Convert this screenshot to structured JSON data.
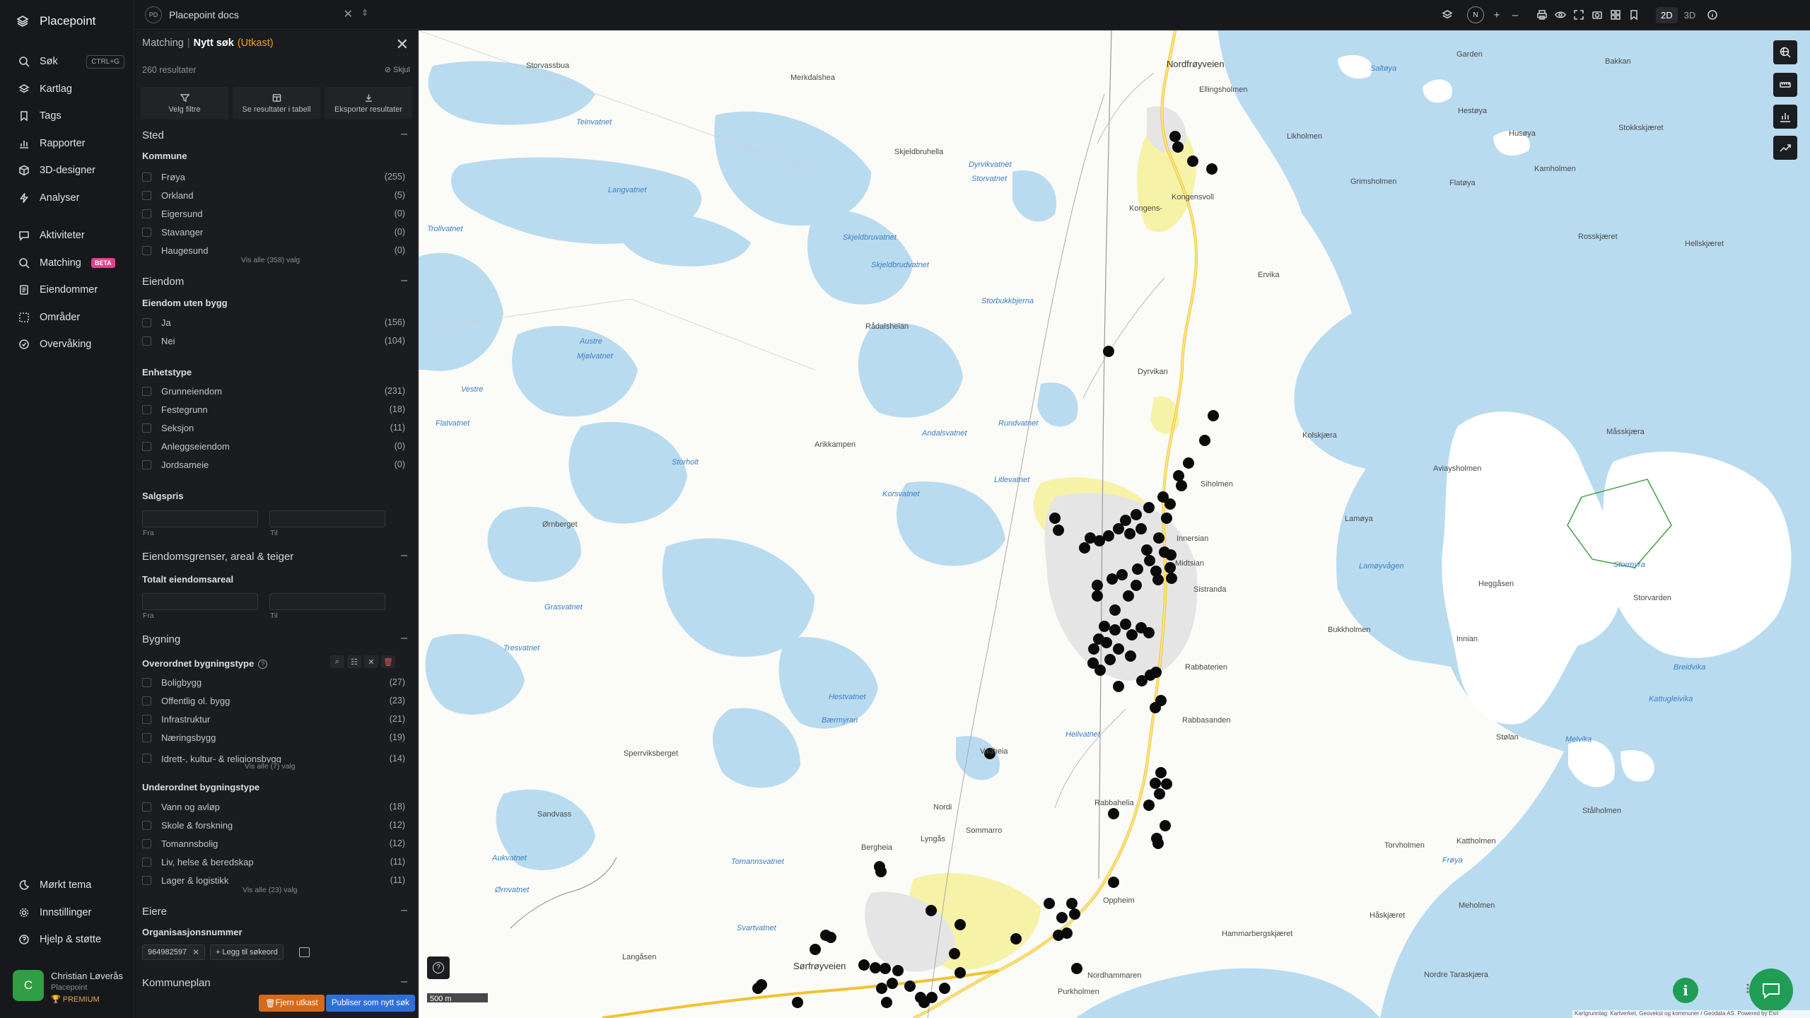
{
  "brand": {
    "name": "Placepoint"
  },
  "nav": {
    "items": [
      {
        "label": "Søk",
        "shortcut": "CTRL+G"
      },
      {
        "label": "Kartlag"
      },
      {
        "label": "Tags"
      },
      {
        "label": "Rapporter"
      },
      {
        "label": "3D-designer"
      },
      {
        "label": "Analyser"
      },
      {
        "label": "Aktiviteter"
      },
      {
        "label": "Matching",
        "badge": "BETA"
      },
      {
        "label": "Eiendommer"
      },
      {
        "label": "Områder"
      },
      {
        "label": "Overvåking"
      }
    ],
    "bottom": [
      {
        "label": "Mørkt tema"
      },
      {
        "label": "Innstillinger"
      },
      {
        "label": "Hjelp & støtte"
      }
    ]
  },
  "user": {
    "initial": "C",
    "name": "Christian Løverås",
    "org": "Placepoint",
    "plan": "PREMIUM"
  },
  "doc": {
    "badge": "PD",
    "title": "Placepoint docs"
  },
  "view": {
    "compass": "N",
    "mode_2d": "2D",
    "mode_3d": "3D"
  },
  "panel": {
    "crumb_parent": "Matching",
    "crumb_current": "Nytt søk",
    "crumb_status": "(Utkast)",
    "count": "260 resultater",
    "hide": "Skjul",
    "actions": [
      "Velg filtre",
      "Se resultater i tabell",
      "Eksporter resultater"
    ],
    "sted": {
      "title": "Sted",
      "kommune_title": "Kommune",
      "options": [
        {
          "label": "Frøya",
          "count": "(255)"
        },
        {
          "label": "Orkland",
          "count": "(5)"
        },
        {
          "label": "Eigersund",
          "count": "(0)"
        },
        {
          "label": "Stavanger",
          "count": "(0)"
        },
        {
          "label": "Haugesund",
          "count": "(0)"
        }
      ],
      "show_all": "Vis alle (358) valg"
    },
    "eiendom": {
      "title": "Eiendom",
      "uten_bygg_title": "Eiendom uten bygg",
      "uten_bygg": [
        {
          "label": "Ja",
          "count": "(156)"
        },
        {
          "label": "Nei",
          "count": "(104)"
        }
      ],
      "enhetstype_title": "Enhetstype",
      "enhetstype": [
        {
          "label": "Grunneiendom",
          "count": "(231)"
        },
        {
          "label": "Festegrunn",
          "count": "(18)"
        },
        {
          "label": "Seksjon",
          "count": "(11)"
        },
        {
          "label": "Anleggseiendom",
          "count": "(0)"
        },
        {
          "label": "Jordsameie",
          "count": "(0)"
        }
      ],
      "salgspris_title": "Salgspris",
      "from": "Fra",
      "to": "Til"
    },
    "grenser": {
      "title": "Eiendomsgrenser, areal & teiger",
      "areal_title": "Totalt eiendomsareal",
      "from": "Fra",
      "to": "Til"
    },
    "bygning": {
      "title": "Bygning",
      "overordnet_title": "Overordnet bygningstype",
      "overordnet": [
        {
          "label": "Boligbygg",
          "count": "(27)"
        },
        {
          "label": "Offentlig ol. bygg",
          "count": "(23)"
        },
        {
          "label": "Infrastruktur",
          "count": "(21)"
        },
        {
          "label": "Næringsbygg",
          "count": "(19)"
        },
        {
          "label": "Idrett-, kultur- & religionsbygg",
          "count": "(14)"
        }
      ],
      "overordnet_show_all": "Vis alle (7) valg",
      "underordnet_title": "Underordnet bygningstype",
      "underordnet": [
        {
          "label": "Vann og avløp",
          "count": "(18)"
        },
        {
          "label": "Skole & forskning",
          "count": "(12)"
        },
        {
          "label": "Tomannsbolig",
          "count": "(12)"
        },
        {
          "label": "Liv, helse & beredskap",
          "count": "(11)"
        },
        {
          "label": "Lager & logistikk",
          "count": "(11)"
        }
      ],
      "underordnet_show_all": "Vis alle (23) valg"
    },
    "eiere": {
      "title": "Eiere",
      "org_title": "Organisasjonsnummer",
      "org_chip": "964982597",
      "add_keyword": "+ Legg til søkeord"
    },
    "kommuneplan": {
      "title": "Kommuneplan"
    },
    "remove_draft": "Fjern utkast",
    "publish": "Publiser som nytt søk"
  },
  "map": {
    "scale": "500 m",
    "attribution": "Kartgrunnlag: Kartverket, Geovekst og kommuner / Geodata AS. Powered by Esri",
    "labels": [
      "Garden",
      "Bakkan",
      "Saltøya",
      "Hestøya",
      "Husøya",
      "Stokkskjæret",
      "Likholmen",
      "Kamholmen",
      "Grimsholmen",
      "Flatøya",
      "Rosskjæret",
      "Hellskjæret",
      "Ellingsholmen",
      "Dyrvikvatnet",
      "Storvatnet",
      "Kongensvoll",
      "Kongens-",
      "Ervika",
      "Dyrvikan",
      "Kolskjæra",
      "Aviaysholmen",
      "Måsskjæra",
      "Siholmen",
      "Lamøya",
      "Lamøyvågen",
      "Innersian",
      "Midtsian",
      "Sistranda",
      "Heggåsen",
      "Stormyra",
      "Storvarden",
      "Bukkholmen",
      "Rabbaterien",
      "Rabbasanden",
      "Innian",
      "Breidvika",
      "Kattugleivika",
      "Stølan",
      "Melvika",
      "Stålholmen",
      "Rabbahelia",
      "Torvholmen",
      "Kattholmen",
      "Meholmen",
      "Håskjæret",
      "Hammarbergskjæret",
      "Nordre Taraskjæra",
      "Nordhammaren",
      "Purkholmen",
      "Oppheim",
      "Sørfrøyveien",
      "Bergheia",
      "Nordi",
      "Sommarro",
      "Lyngås",
      "Langåsen",
      "Svartvatnet",
      "Tomannsvatnet",
      "Aukvatnet",
      "Hestvatnet",
      "Bærmyran",
      "Sperrviksberget",
      "Ørnberget",
      "Rådalsheian",
      "Arikkampen",
      "Storbukkbjerna",
      "Skjeldbruvatnet",
      "Langvatnet",
      "Teinvatnet",
      "Merkdalshea",
      "Storvassbua",
      "Skjeldbruhella",
      "Trollvatnet",
      "Vestre",
      "Austre",
      "Andalsvatnet",
      "Korsvatnet",
      "Storholt",
      "Grasvatnet",
      "Sandvass",
      "Ørnvatnet",
      "Nordfrøyveien",
      "Frøya",
      "Vadheia",
      "Heilvatnet",
      "Litlevatnet",
      "Mjølvatnet",
      "Flatvatnet",
      "Rundvatnet",
      "Skjeldbrudvatnet",
      "Tresvatnet"
    ]
  }
}
